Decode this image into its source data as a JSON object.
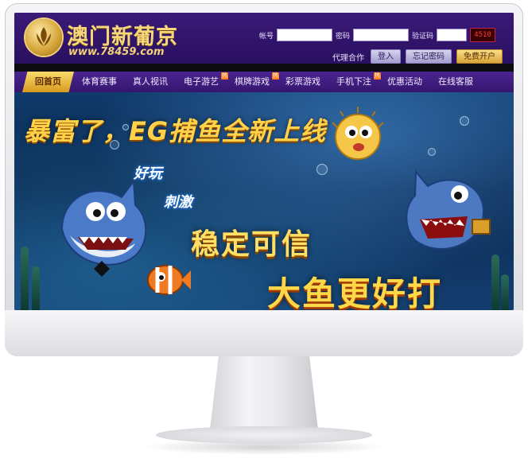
{
  "site": {
    "brand_name": "澳门新葡京",
    "brand_url": "www.78459.com"
  },
  "login": {
    "account_label": "帐号",
    "password_label": "密码",
    "code_label": "验证码",
    "captcha_value": "4510",
    "agent_link": "代理合作",
    "login_button": "登入",
    "forgot_button": "忘记密码",
    "register_button": "免费开户"
  },
  "nav": {
    "items": [
      {
        "label": "回首页",
        "active": true,
        "hot": false
      },
      {
        "label": "体育赛事",
        "active": false,
        "hot": false
      },
      {
        "label": "真人视讯",
        "active": false,
        "hot": false
      },
      {
        "label": "电子游艺",
        "active": false,
        "hot": true
      },
      {
        "label": "棋牌游戏",
        "active": false,
        "hot": true
      },
      {
        "label": "彩票游戏",
        "active": false,
        "hot": false
      },
      {
        "label": "手机下注",
        "active": false,
        "hot": true
      },
      {
        "label": "优惠活动",
        "active": false,
        "hot": false
      },
      {
        "label": "在线客服",
        "active": false,
        "hot": false
      }
    ],
    "hot_badge": "热"
  },
  "banner": {
    "title": "暴富了，EG捕鱼全新上线",
    "fun": "好玩",
    "exciting": "刺激",
    "stable": "稳定可信",
    "bigfish": "大鱼更好打"
  },
  "colors": {
    "header_bg": "#2a1060",
    "nav_bg": "#35166e",
    "gold": "#f7d77a",
    "active_tab": "#f0b83a"
  }
}
